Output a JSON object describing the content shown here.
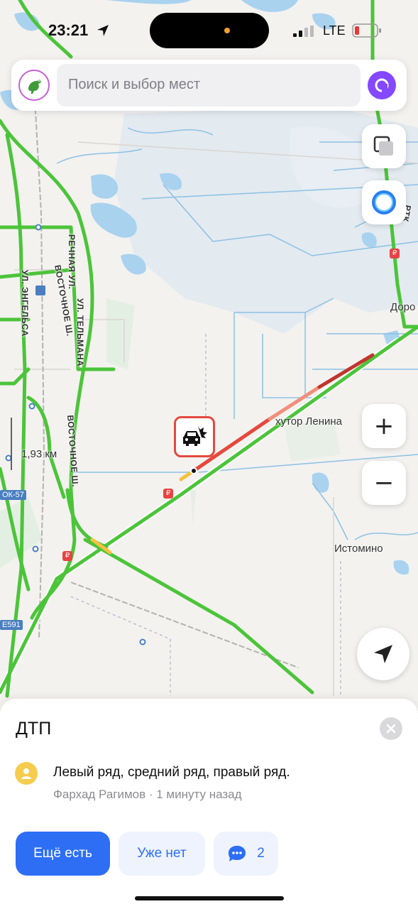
{
  "status_bar": {
    "time": "23:21",
    "network": "LTE"
  },
  "search": {
    "placeholder": "Поиск и выбор мест"
  },
  "map": {
    "labels": {
      "hutor_lenina": "хутор Ленина",
      "istomino": "Истомино",
      "doro": "Доро",
      "scale": "1,93 км",
      "vostochnoe_1": "ВОСТОЧНОЕ Ш.",
      "vostochnoe_2": "ВОСТОЧНОЕ Ш.",
      "rechnaya": "РЕЧНАЯ УЛ.",
      "telmana": "УЛ. ТЕЛЬМАНА",
      "engelsa": "УЛ. ЭНГЕЛЬСА",
      "rtk": "РТК"
    },
    "road_badges": {
      "ok57": "ОК-57",
      "e591": "Е591"
    },
    "incident_icon": "car-crash-icon"
  },
  "controls": {
    "layers": "layers-icon",
    "alice": "alice-icon",
    "zoom_in": "+",
    "zoom_out": "−",
    "my_location": "navigation-arrow-icon"
  },
  "incident_sheet": {
    "title": "ДТП",
    "comment": "Левый ряд, средний ряд, правый ряд.",
    "meta": "Фархад Рагимов · 1 минуту назад",
    "still_there_label": "Ещё есть",
    "gone_label": "Уже нет",
    "comments_count": "2"
  },
  "colors": {
    "accent": "#2d6ef5",
    "traffic_green": "#4cc43a",
    "traffic_red": "#e5483d",
    "incident_red": "#e34a3f"
  }
}
